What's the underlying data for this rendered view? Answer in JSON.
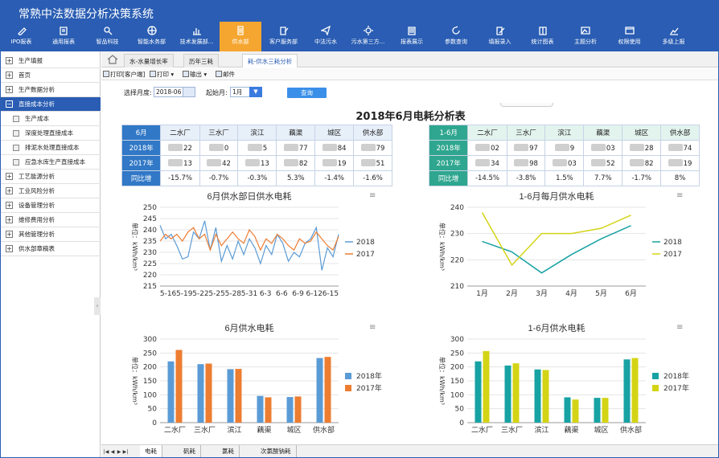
{
  "app_title": "常熟中法数据分析决策系统",
  "nav": [
    {
      "label": "IPO报表",
      "icon": "pencil-icon"
    },
    {
      "label": "通用报表",
      "icon": "report-icon"
    },
    {
      "label": "智品科技",
      "icon": "search-icon"
    },
    {
      "label": "智能水务部",
      "icon": "globe-icon"
    },
    {
      "label": "技术发展部...",
      "icon": "bar-chart-icon"
    },
    {
      "label": "供水部",
      "icon": "document-icon"
    },
    {
      "label": "客户服务部",
      "icon": "edit-icon"
    },
    {
      "label": "中法污水",
      "icon": "send-icon"
    },
    {
      "label": "污水第三方...",
      "icon": "gear-icon"
    },
    {
      "label": "报表展示",
      "icon": "list-icon"
    },
    {
      "label": "参数查询",
      "icon": "refresh-icon"
    },
    {
      "label": "填报录入",
      "icon": "write-icon"
    },
    {
      "label": "统计图表",
      "icon": "book-icon"
    },
    {
      "label": "主题分析",
      "icon": "image-icon"
    },
    {
      "label": "权限使用",
      "icon": "window-icon"
    },
    {
      "label": "多级上报",
      "icon": "chart-icon"
    }
  ],
  "sidebar": [
    {
      "label": "生产填报",
      "type": "plus"
    },
    {
      "label": "首页",
      "type": "plus"
    },
    {
      "label": "生产数据分析",
      "type": "plus"
    },
    {
      "label": "直接成本分析",
      "type": "minus"
    },
    {
      "label": "生产成本",
      "type": "sub"
    },
    {
      "label": "深度处理直接成本",
      "type": "sub"
    },
    {
      "label": "排泥水处理直接成本",
      "type": "sub"
    },
    {
      "label": "应急水库生产直接成本",
      "type": "sub"
    },
    {
      "label": "工艺能源分析",
      "type": "plus"
    },
    {
      "label": "工业风险分析",
      "type": "plus"
    },
    {
      "label": "设备管理分析",
      "type": "plus"
    },
    {
      "label": "维修费用分析",
      "type": "plus"
    },
    {
      "label": "其他管理分析",
      "type": "plus"
    },
    {
      "label": "供水部章稿表",
      "type": "plus"
    }
  ],
  "tabs": [
    "水-水量增长率",
    "历年三耗",
    "耗-供水三耗分析"
  ],
  "toolbar": {
    "print_client": "打印[客户端]",
    "print": "打印",
    "export": "输出",
    "mail": "邮件"
  },
  "filter": {
    "month_label": "选择月度:",
    "month_value": "2018-06",
    "start_label": "起始月:",
    "start_value": "1月",
    "query": "查询"
  },
  "report_title": "2018年6月电耗分析表",
  "table_month": {
    "header": [
      "6月",
      "二水厂",
      "三水厂",
      "滨江",
      "藕渠",
      "城区",
      "供水部"
    ],
    "rows": [
      {
        "label": "2018年",
        "cells": [
          "22",
          "0",
          "5",
          "77",
          "84",
          "79"
        ]
      },
      {
        "label": "2017年",
        "cells": [
          "13",
          "42",
          "13",
          "82",
          "19",
          "51"
        ]
      },
      {
        "label": "同比增",
        "cells": [
          "-15.7%",
          "-0.7%",
          "-0.3%",
          "5.3%",
          "-1.4%",
          "-1.6%"
        ]
      }
    ]
  },
  "table_ytd": {
    "header": [
      "1-6月",
      "二水厂",
      "三水厂",
      "滨江",
      "藕渠",
      "城区",
      "供水部"
    ],
    "rows": [
      {
        "label": "2018年",
        "cells": [
          "02",
          "97",
          "9",
          "03",
          "28",
          "74"
        ]
      },
      {
        "label": "2017年",
        "cells": [
          "34",
          "98",
          "03",
          "52",
          "82",
          "19"
        ]
      },
      {
        "label": "同比增",
        "cells": [
          "-14.5%",
          "-3.8%",
          "1.5%",
          "7.7%",
          "-1.7%",
          "8%"
        ]
      }
    ]
  },
  "chart_data": [
    {
      "type": "line",
      "title": "6月供水部日供水电耗",
      "ylabel": "单位：kWh/km³",
      "ylim": [
        215,
        250
      ],
      "yticks": [
        215,
        220,
        225,
        230,
        235,
        240,
        245,
        250
      ],
      "x_labels": [
        "5-16",
        "5-19",
        "5-22",
        "5-25",
        "5-28",
        "5-31",
        "6-3",
        "6-6",
        "6-9",
        "6-12",
        "6-15"
      ],
      "series": [
        {
          "name": "2018",
          "color": "#5b9bd5",
          "values": [
            242,
            236,
            238,
            233,
            227,
            228,
            239,
            236,
            244,
            231,
            241,
            226,
            233,
            227,
            235,
            229,
            236,
            232,
            225,
            233,
            229,
            238,
            234,
            226,
            230,
            228,
            234,
            236,
            241,
            222,
            232,
            228,
            238
          ]
        },
        {
          "name": "2017",
          "color": "#ed7d31",
          "values": [
            235,
            238,
            236,
            238,
            235,
            239,
            241,
            236,
            238,
            231,
            238,
            233,
            236,
            239,
            236,
            234,
            240,
            237,
            231,
            236,
            234,
            238,
            236,
            233,
            231,
            236,
            234,
            235,
            239,
            236,
            233,
            231,
            237
          ]
        }
      ],
      "legend": "right"
    },
    {
      "type": "line",
      "title": "1-6月每月供水电耗",
      "ylabel": "单位：kWh/km³",
      "ylim": [
        210,
        240
      ],
      "yticks": [
        210,
        220,
        230,
        240
      ],
      "categories": [
        "1月",
        "2月",
        "3月",
        "4月",
        "5月",
        "6月"
      ],
      "series": [
        {
          "name": "2018",
          "color": "#17a2a3",
          "values": [
            227,
            223,
            215,
            222,
            228,
            233
          ]
        },
        {
          "name": "2017",
          "color": "#d4d417",
          "values": [
            238,
            218,
            230,
            230,
            232,
            237
          ]
        }
      ],
      "legend": "right"
    },
    {
      "type": "bar",
      "title": "6月供水电耗",
      "ylabel": "单位：kWh/km³",
      "ylim": [
        0,
        300
      ],
      "yticks": [
        0,
        50,
        100,
        150,
        200,
        250,
        300
      ],
      "categories": [
        "二水厂",
        "三水厂",
        "滨江",
        "藕渠",
        "城区",
        "供水部"
      ],
      "series": [
        {
          "name": "2018年",
          "color": "#5b9bd5",
          "values": [
            220,
            210,
            192,
            96,
            92,
            232
          ]
        },
        {
          "name": "2017年",
          "color": "#ed7d31",
          "values": [
            261,
            212,
            193,
            91,
            94,
            236
          ]
        }
      ],
      "legend": "right"
    },
    {
      "type": "bar",
      "title": "1-6月供水电耗",
      "ylabel": "单位：kWh/km³",
      "ylim": [
        0,
        300
      ],
      "yticks": [
        0,
        50,
        100,
        150,
        200,
        250,
        300
      ],
      "categories": [
        "二水厂",
        "三水厂",
        "滨江",
        "藕渠",
        "城区",
        "供水部"
      ],
      "series": [
        {
          "name": "2018年",
          "color": "#17a2a3",
          "values": [
            220,
            205,
            191,
            91,
            89,
            227
          ]
        },
        {
          "name": "2017年",
          "color": "#d4d417",
          "values": [
            257,
            213,
            189,
            83,
            89,
            232
          ]
        }
      ],
      "legend": "right"
    }
  ],
  "bottom_tabs": [
    "电耗",
    "矾耗",
    "氯耗",
    "次氯酸钠耗"
  ]
}
